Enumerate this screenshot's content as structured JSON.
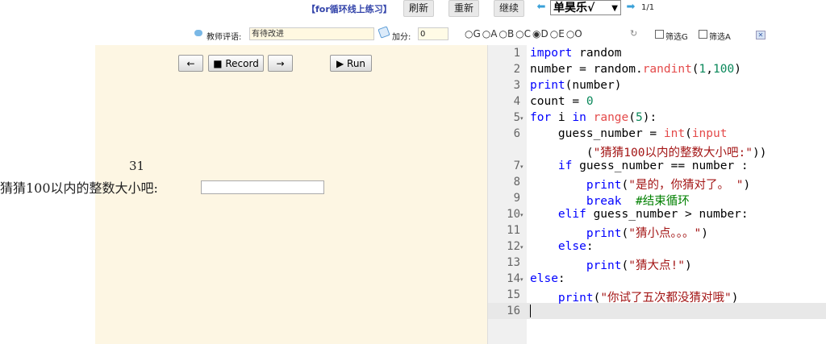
{
  "toolbar": {
    "title": "【for循环线上练习】",
    "refresh_label": "刷新",
    "restart_label": "重新",
    "continue_label": "继续",
    "student_selected": "单昊乐√",
    "page_count": "1/1"
  },
  "review": {
    "comment_label": "教师评语:",
    "comment_value": "有待改进",
    "score_label": "加分:",
    "score_value": "0",
    "grades": [
      "○G",
      "○A",
      "○B",
      "○C",
      "◉D",
      "○E",
      "○O"
    ],
    "filter_g_label": "筛选G",
    "filter_a_label": "筛选A"
  },
  "controls": {
    "back_label": "←",
    "record_label": "Record",
    "forward_label": "→",
    "run_label": "Run"
  },
  "output": {
    "number": "31",
    "prompt": "猜猜100以内的整数大小吧:"
  },
  "editor": {
    "lines": [
      {
        "n": "1",
        "fold": ""
      },
      {
        "n": "2",
        "fold": ""
      },
      {
        "n": "3",
        "fold": ""
      },
      {
        "n": "4",
        "fold": ""
      },
      {
        "n": "5",
        "fold": "▾"
      },
      {
        "n": "6",
        "fold": ""
      },
      {
        "n": "7",
        "fold": "▾"
      },
      {
        "n": "8",
        "fold": ""
      },
      {
        "n": "9",
        "fold": ""
      },
      {
        "n": "10",
        "fold": "▾"
      },
      {
        "n": "11",
        "fold": ""
      },
      {
        "n": "12",
        "fold": "▾"
      },
      {
        "n": "13",
        "fold": ""
      },
      {
        "n": "14",
        "fold": "▾"
      },
      {
        "n": "15",
        "fold": ""
      },
      {
        "n": "16",
        "fold": ""
      }
    ],
    "code": {
      "l1_kw": "import",
      "l1_rest": " random",
      "l2_a": "number = random.",
      "l2_fn": "randint",
      "l2_b": "(",
      "l2_n1": "1",
      "l2_c": ",",
      "l2_n2": "100",
      "l2_d": ")",
      "l3_kw": "print",
      "l3_rest": "(number)",
      "l4_a": "count = ",
      "l4_n": "0",
      "l5_kw1": "for",
      "l5_a": " i ",
      "l5_kw2": "in",
      "l5_b": " ",
      "l5_fn": "range",
      "l5_c": "(",
      "l5_n": "5",
      "l5_d": "):",
      "l6_a": "    guess_number = ",
      "l6_fn1": "int",
      "l6_b": "(",
      "l6_fn2": "input",
      "l6w_a": "        (",
      "l6w_str": "\"猜猜100以内的整数大小吧:\"",
      "l6w_b": "))",
      "l7_a": "    ",
      "l7_kw": "if",
      "l7_b": " guess_number == number :",
      "l8_a": "        ",
      "l8_kw": "print",
      "l8_b": "(",
      "l8_str": "\"是的，你猜对了。 \"",
      "l8_c": ")",
      "l9_a": "        ",
      "l9_kw": "break",
      "l9_b": "  ",
      "l9_cm": "#结束循环",
      "l10_a": "    ",
      "l10_kw": "elif",
      "l10_b": " guess_number > number:",
      "l11_a": "        ",
      "l11_kw": "print",
      "l11_b": "(",
      "l11_str": "\"猜小点。。。\"",
      "l11_c": ")",
      "l12_a": "    ",
      "l12_kw": "else",
      "l12_b": ":",
      "l13_a": "        ",
      "l13_kw": "print",
      "l13_b": "(",
      "l13_str": "\"猜大点!\"",
      "l13_c": ")",
      "l14_kw": "else",
      "l14_b": ":",
      "l15_a": "    ",
      "l15_kw": "print",
      "l15_b": "(",
      "l15_str": "\"你试了五次都没猜对哦\"",
      "l15_c": ")"
    }
  },
  "colors": {
    "panel_bg": "#fdf6e3",
    "keyword": "#0000ff",
    "function": "#e44a4a",
    "number": "#09885a",
    "string": "#a31515",
    "comment": "#008000"
  }
}
